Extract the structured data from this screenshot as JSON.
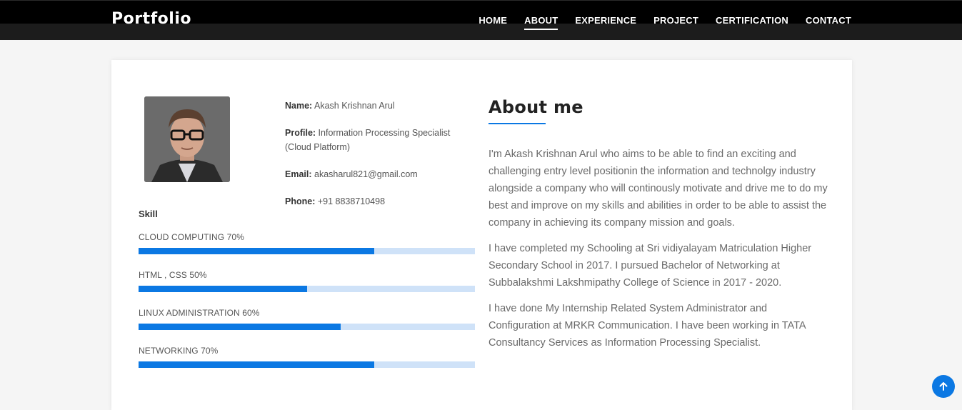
{
  "navbar": {
    "brand": "Portfolio",
    "links": [
      {
        "label": "HOME",
        "active": false
      },
      {
        "label": "ABOUT",
        "active": true
      },
      {
        "label": "EXPERIENCE",
        "active": false
      },
      {
        "label": "PROJECT",
        "active": false
      },
      {
        "label": "CERTIFICATION",
        "active": false
      },
      {
        "label": "CONTACT",
        "active": false
      }
    ]
  },
  "profile": {
    "name_label": "Name:",
    "name": "Akash Krishnan Arul",
    "profile_label": "Profile:",
    "profile": "Information Processing Specialist (Cloud Platform)",
    "email_label": "Email:",
    "email": "akasharul821@gmail.com",
    "phone_label": "Phone:",
    "phone": "+91 8838710498"
  },
  "skills": {
    "title": "Skill",
    "items": [
      {
        "label": "CLOUD COMPUTING 70%",
        "percent": 70
      },
      {
        "label": "HTML , CSS 50%",
        "percent": 50
      },
      {
        "label": "LINUX ADMINISTRATION 60%",
        "percent": 60
      },
      {
        "label": "NETWORKING 70%",
        "percent": 70
      }
    ]
  },
  "about": {
    "title": "About me",
    "paragraphs": [
      "I'm Akash Krishnan Arul who aims to be able to find an exciting and challenging entry level positionin the information and technolgy industry alongside a company who will continously motivate and drive me to do my best and improve on my skills and abilities in order to be able to assist the company in achieving its company mission and goals.",
      "I have completed my Schooling at Sri vidiyalayam Matriculation Higher Secondary School in 2017. I pursued Bachelor of Networking at Subbalakshmi Lakshmipathy College of Science in 2017 - 2020.",
      "I have done My Internship Related System Administrator and Configuration at MRKR Communication. I have been working in TATA Consultancy Services as Information Processing Specialist."
    ]
  },
  "icons": {
    "scroll_top": "arrow-up-icon",
    "photo": "profile-photo"
  },
  "colors": {
    "accent": "#0b78e3",
    "bar_track": "#cfe2f8",
    "navbar": "#000000"
  }
}
